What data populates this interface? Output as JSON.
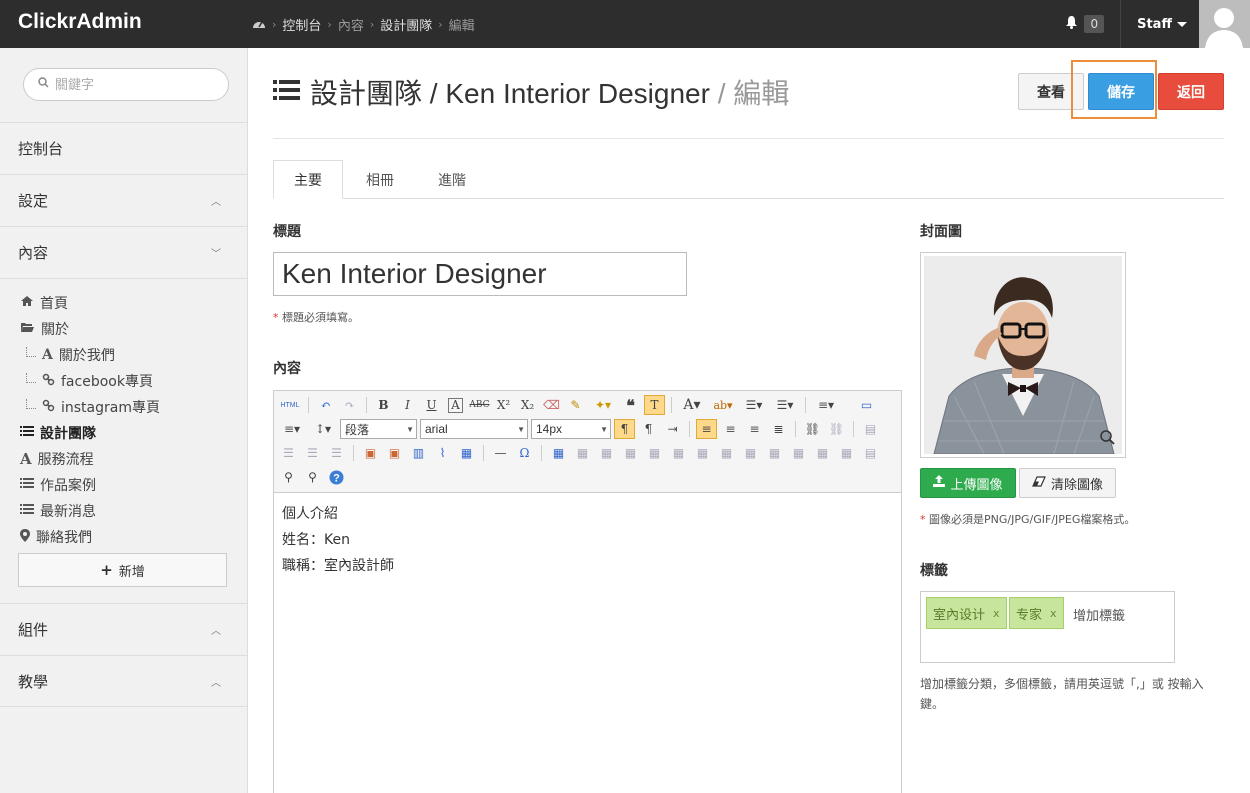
{
  "app": {
    "brand": "ClickrAdmin"
  },
  "breadcrumb": [
    "控制台",
    "內容",
    "設計團隊",
    "編輯"
  ],
  "notifications": {
    "count": "0"
  },
  "user": {
    "name": "Staff"
  },
  "sidebar": {
    "search_placeholder": "關鍵字",
    "sections": {
      "dashboard": "控制台",
      "settings": "設定",
      "content": "內容",
      "components": "組件",
      "tutorial": "教學"
    },
    "items": [
      {
        "label": "首頁",
        "icon": "home-icon"
      },
      {
        "label": "關於",
        "icon": "folder-open-icon"
      },
      {
        "label": "關於我們",
        "icon": "font-icon"
      },
      {
        "label": "facebook專頁",
        "icon": "link-icon"
      },
      {
        "label": "instagram專頁",
        "icon": "link-icon"
      },
      {
        "label": "設計團隊",
        "icon": "list-icon"
      },
      {
        "label": "服務流程",
        "icon": "font-icon"
      },
      {
        "label": "作品案例",
        "icon": "list-icon"
      },
      {
        "label": "最新消息",
        "icon": "list-icon"
      },
      {
        "label": "聯絡我們",
        "icon": "map-marker-icon"
      }
    ],
    "add_label": "新增"
  },
  "page": {
    "title_section": "設計團隊",
    "title_item": "Ken Interior Designer",
    "title_action": "編輯",
    "sep": "/",
    "buttons": {
      "view": "查看",
      "save": "儲存",
      "back": "返回"
    }
  },
  "tabs": [
    "主要",
    "相冊",
    "進階"
  ],
  "form": {
    "title_label": "標題",
    "title_value": "Ken Interior Designer",
    "title_help": "標題必須填寫。",
    "content_label": "內容",
    "content_lines": [
      "個人介紹",
      "姓名：Ken",
      "職稱：室內設計師"
    ],
    "toolbar": {
      "html": "HTML",
      "format": "段落",
      "font": "arial",
      "size": "14px"
    },
    "cover_label": "封面圖",
    "upload_label": "上傳圖像",
    "clear_label": "清除圖像",
    "cover_help": "圖像必須是PNG/JPG/GIF/JPEG檔案格式。",
    "tags_label": "標籤",
    "tags": [
      "室內设计",
      "专家"
    ],
    "tags_placeholder": "增加標籤",
    "tags_help": "增加標籤分類，多個標籤，請用英逗號「,」或 按輸入鍵。"
  },
  "colors": {
    "navbar": "#2d2d2d",
    "save": "#3a9ee2",
    "back": "#e74c3c",
    "upload": "#2eac4d",
    "tag": "#c7e59c",
    "highlight": "#ec8f3b"
  }
}
